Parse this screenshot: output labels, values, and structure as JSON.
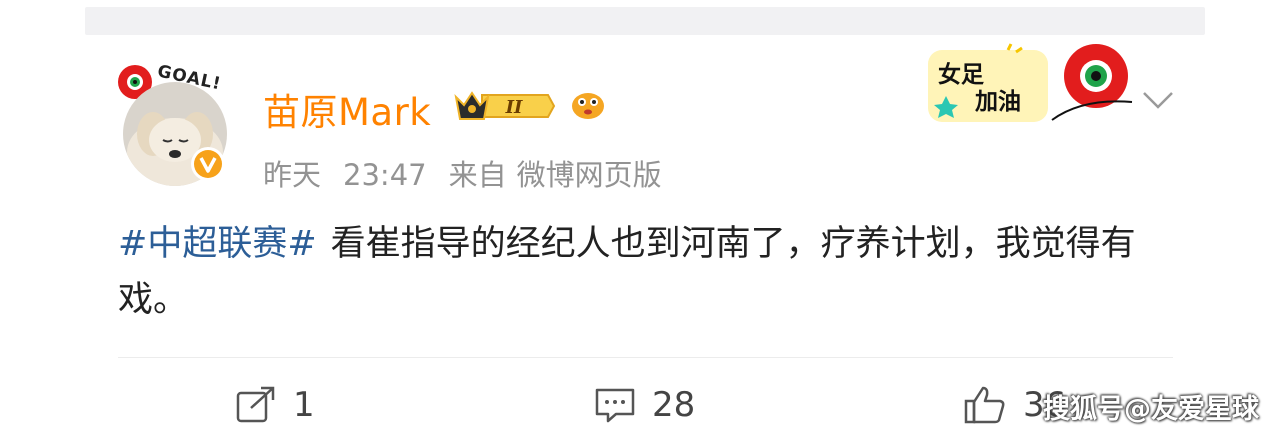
{
  "user": {
    "name": "苗原Mark",
    "rank_badge_text": "II",
    "avatar_sticker_text": "GOAL!"
  },
  "meta": {
    "date": "昨天",
    "time": "23:47",
    "source_prefix": "来自",
    "source": "微博网页版"
  },
  "sticker": {
    "line1": "女足",
    "line2": "加油"
  },
  "post": {
    "hashtag": "#中超联赛#",
    "text": "看崔指导的经纪人也到河南了，疗养计划，我觉得有戏。"
  },
  "actions": {
    "repost_count": "1",
    "comment_count": "28",
    "like_count": "36"
  },
  "watermark": "搜狐号@友爱星球",
  "colors": {
    "username": "#ff8200",
    "hashtag": "#2c5e97",
    "meta": "#939393",
    "body_text": "#222222"
  }
}
